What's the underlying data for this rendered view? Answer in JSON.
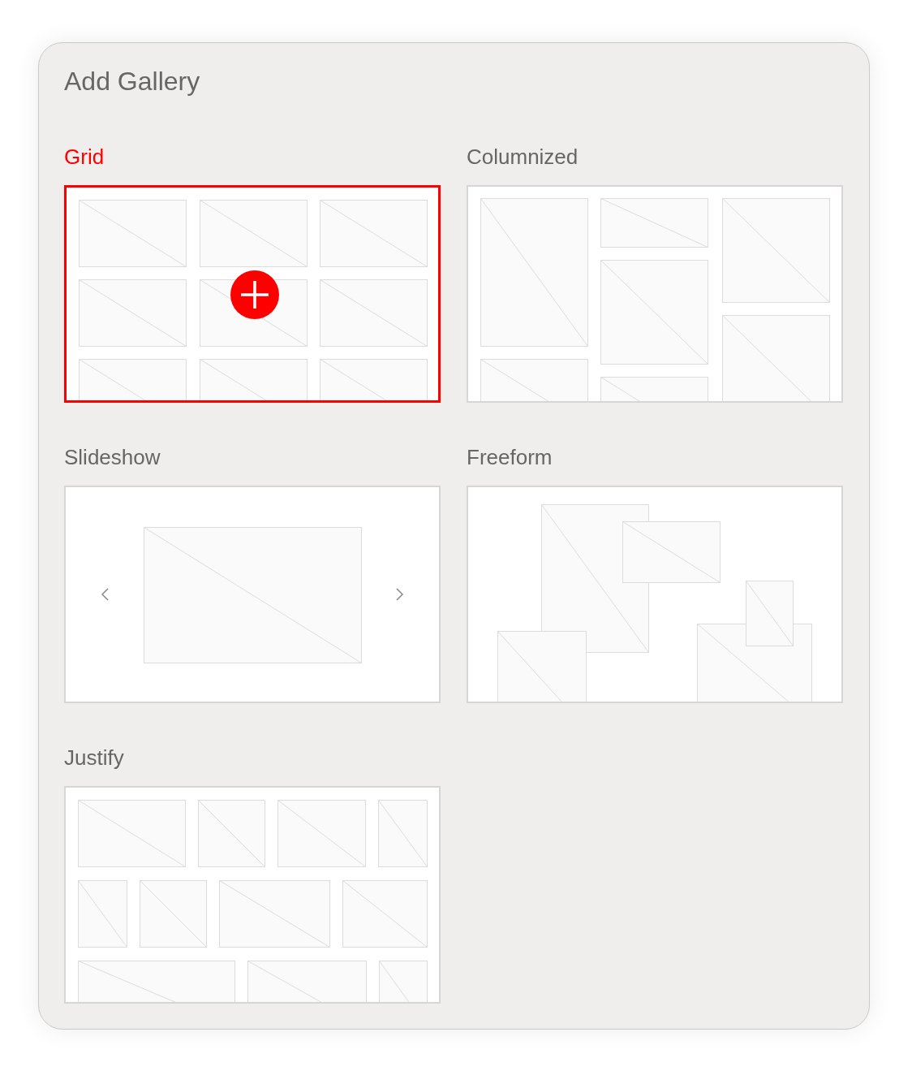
{
  "panel": {
    "title": "Add Gallery"
  },
  "galleries": [
    {
      "label": "Grid",
      "kind": "grid",
      "selected": true
    },
    {
      "label": "Columnized",
      "kind": "columnized",
      "selected": false
    },
    {
      "label": "Slideshow",
      "kind": "slideshow",
      "selected": false
    },
    {
      "label": "Freeform",
      "kind": "freeform",
      "selected": false
    },
    {
      "label": "Justify",
      "kind": "justify",
      "selected": false
    }
  ]
}
